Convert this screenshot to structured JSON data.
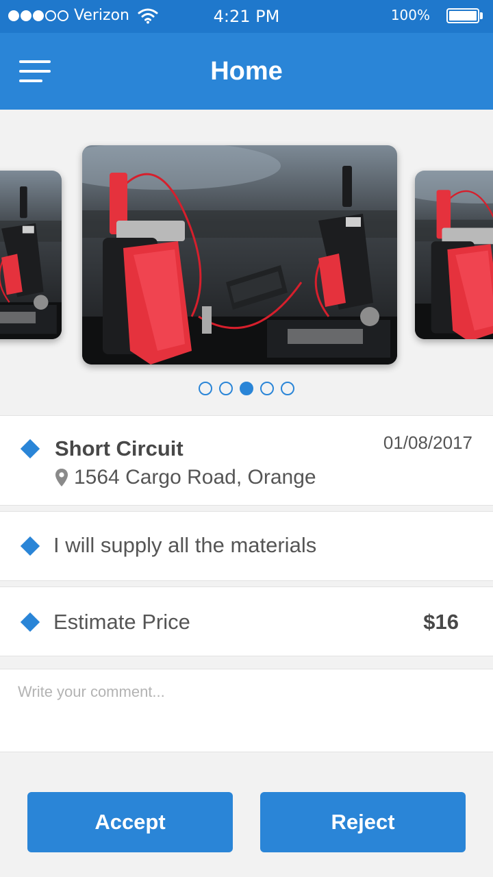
{
  "status_bar": {
    "carrier": "Verizon",
    "time": "4:21 PM",
    "battery": "100%",
    "signal_bars": 3,
    "signal_total": 5
  },
  "nav": {
    "title": "Home",
    "menu_icon": "hamburger-menu-icon"
  },
  "carousel": {
    "slide_count": 5,
    "active_index": 2,
    "image_subject": "jump starter clamps on car battery"
  },
  "job": {
    "title": "Short Circuit",
    "date": "01/08/2017",
    "address": "1564 Cargo Road, Orange"
  },
  "materials": {
    "text": "I will supply all the materials"
  },
  "price": {
    "label": "Estimate Price",
    "value": "$16"
  },
  "comment": {
    "placeholder": "Write your comment..."
  },
  "actions": {
    "accept_label": "Accept",
    "reject_label": "Reject"
  },
  "colors": {
    "status_bar": "#1f78cc",
    "primary": "#2a85d7",
    "background": "#f2f2f2",
    "clamp_red": "#e5323d"
  }
}
